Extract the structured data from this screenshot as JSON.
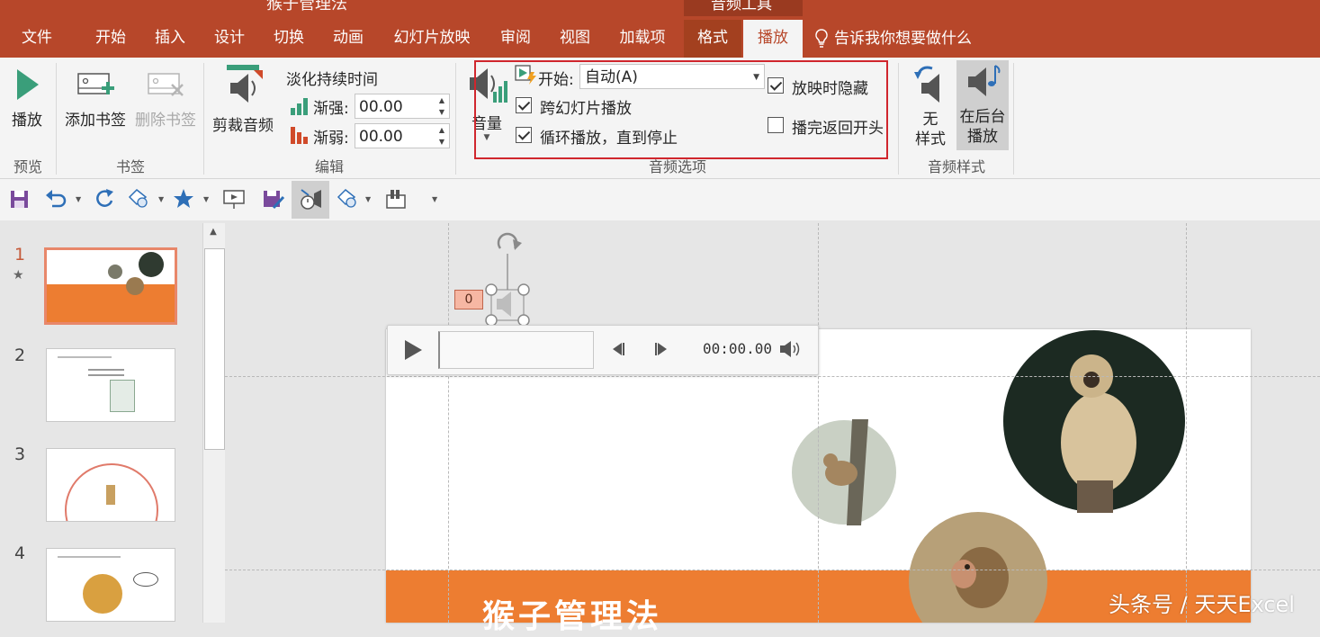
{
  "window": {
    "title_parts": [
      "猴子管理法",
      "音频工具"
    ]
  },
  "tabs": [
    {
      "label": "文件",
      "active": false
    },
    {
      "label": "开始",
      "active": false
    },
    {
      "label": "插入",
      "active": false
    },
    {
      "label": "设计",
      "active": false
    },
    {
      "label": "切换",
      "active": false
    },
    {
      "label": "动画",
      "active": false
    },
    {
      "label": "幻灯片放映",
      "active": false
    },
    {
      "label": "审阅",
      "active": false
    },
    {
      "label": "视图",
      "active": false
    },
    {
      "label": "加载项",
      "active": false
    },
    {
      "label": "格式",
      "active": false
    },
    {
      "label": "播放",
      "active": true
    }
  ],
  "tell_me": "告诉我你想要做什么",
  "ribbon": {
    "preview": {
      "play_label": "播放",
      "group_label": "预览"
    },
    "bookmarks": {
      "add_label": "添加书签",
      "remove_label": "删除书签",
      "group_label": "书签"
    },
    "editing": {
      "trim_label": "剪裁音频",
      "fade_title": "淡化持续时间",
      "fade_in_label": "渐强:",
      "fade_in_value": "00.00",
      "fade_out_label": "渐弱:",
      "fade_out_value": "00.00",
      "group_label": "编辑"
    },
    "audio_options": {
      "volume_label": "音量",
      "start_label": "开始:",
      "start_value": "自动(A)",
      "cross_slides_label": "跨幻灯片播放",
      "cross_slides_checked": true,
      "loop_label": "循环播放，直到停止",
      "loop_checked": true,
      "hide_label": "放映时隐藏",
      "hide_checked": true,
      "rewind_label": "播完返回开头",
      "rewind_checked": false,
      "group_label": "音频选项"
    },
    "audio_styles": {
      "no_style_line1": "无",
      "no_style_line2": "样式",
      "background_line1": "在后台",
      "background_line2": "播放",
      "group_label": "音频样式"
    }
  },
  "slides": [
    {
      "number": "1"
    },
    {
      "number": "2"
    },
    {
      "number": "3"
    },
    {
      "number": "4"
    }
  ],
  "editor": {
    "anim_tag": "0",
    "player_time": "00:00.00",
    "slide_title": "猴子管理法",
    "watermark": "头条号 / 天天Excel"
  },
  "colors": {
    "accent": "#b7472a",
    "slide_band": "#ed7d31",
    "highlight": "#d0262d"
  }
}
